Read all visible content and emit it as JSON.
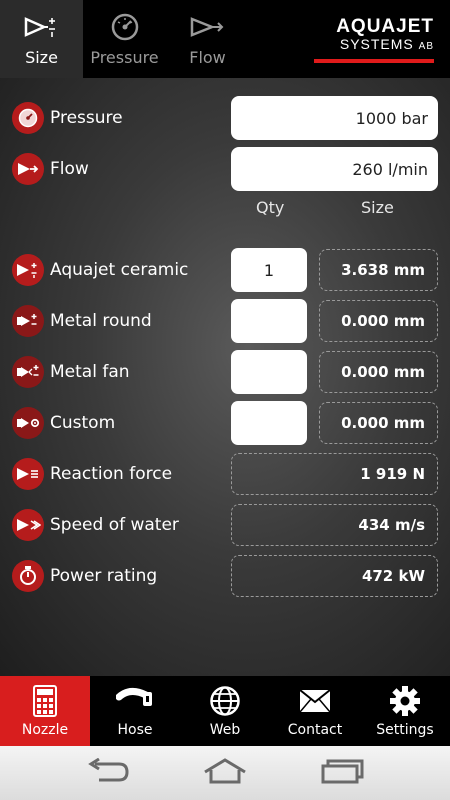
{
  "top_tabs": [
    {
      "label": "Size",
      "icon": "nozzle-size-icon",
      "active": true
    },
    {
      "label": "Pressure",
      "icon": "pressure-gauge-icon",
      "active": false
    },
    {
      "label": "Flow",
      "icon": "flow-icon",
      "active": false
    }
  ],
  "logo": {
    "line1": "AQUAJET",
    "line2": "SYSTEMS",
    "line2_suffix": "AB"
  },
  "inputs": {
    "pressure": {
      "label": "Pressure",
      "value": "1000 bar"
    },
    "flow": {
      "label": "Flow",
      "value": "260 l/min"
    }
  },
  "columns": {
    "qty": "Qty",
    "size": "Size"
  },
  "nozzles": [
    {
      "label": "Aquajet ceramic",
      "qty": "1",
      "size": "3.638 mm"
    },
    {
      "label": "Metal round",
      "qty": "",
      "size": "0.000 mm"
    },
    {
      "label": "Metal fan",
      "qty": "",
      "size": "0.000 mm"
    },
    {
      "label": "Custom",
      "qty": "",
      "size": "0.000 mm"
    }
  ],
  "results": [
    {
      "label": "Reaction force",
      "value": "1 919 N"
    },
    {
      "label": "Speed of water",
      "value": "434 m/s"
    },
    {
      "label": "Power rating",
      "value": "472 kW"
    }
  ],
  "bottom_nav": [
    {
      "label": "Nozzle",
      "icon": "calculator-icon",
      "active": true
    },
    {
      "label": "Hose",
      "icon": "hose-icon",
      "active": false
    },
    {
      "label": "Web",
      "icon": "globe-icon",
      "active": false
    },
    {
      "label": "Contact",
      "icon": "envelope-icon",
      "active": false
    },
    {
      "label": "Settings",
      "icon": "gear-icon",
      "active": false
    }
  ],
  "colors": {
    "accent": "#d81e1e",
    "icon_bg": "#b51c1c",
    "field_bg": "#ffffff"
  }
}
